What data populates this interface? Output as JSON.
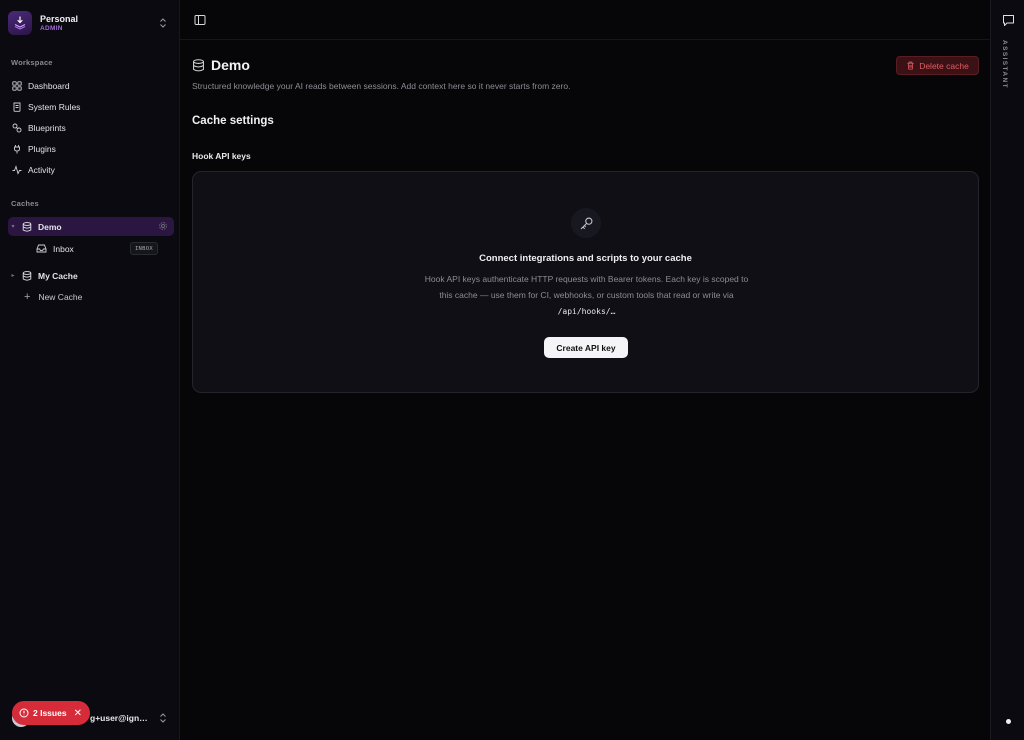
{
  "workspace": {
    "name": "Personal",
    "role": "ADMIN"
  },
  "sidebar": {
    "workspace_label": "Workspace",
    "nav": [
      {
        "label": "Dashboard",
        "icon": "dashboard-icon"
      },
      {
        "label": "System Rules",
        "icon": "scroll-icon"
      },
      {
        "label": "Blueprints",
        "icon": "blueprint-icon"
      },
      {
        "label": "Plugins",
        "icon": "plug-icon"
      },
      {
        "label": "Activity",
        "icon": "activity-icon"
      }
    ],
    "caches_label": "Caches",
    "caches": [
      {
        "name": "Demo",
        "active": true,
        "children": [
          {
            "label": "Inbox",
            "badge": "INBOX"
          }
        ]
      },
      {
        "name": "My Cache",
        "active": false
      }
    ],
    "new_cache_label": "New Cache",
    "user_email": "g+user@ign…",
    "issues_label": "2 Issues"
  },
  "page": {
    "title": "Demo",
    "subtitle": "Structured knowledge your AI reads between sessions. Add context here so it never starts from zero.",
    "delete_label": "Delete cache",
    "section_title": "Cache settings",
    "hook_title": "Hook API keys",
    "empty": {
      "title": "Connect integrations and scripts to your cache",
      "desc": "Hook API keys authenticate HTTP requests with Bearer tokens. Each key is scoped to this cache — use them for CI, webhooks, or custom tools that read or write via",
      "code": "/api/hooks/…",
      "button": "Create API key"
    }
  },
  "rail": {
    "label": "ASSISTANT"
  },
  "colors": {
    "accent": "#a06cd5",
    "active_bg": "#2a1640",
    "danger": "#d62c3a"
  }
}
